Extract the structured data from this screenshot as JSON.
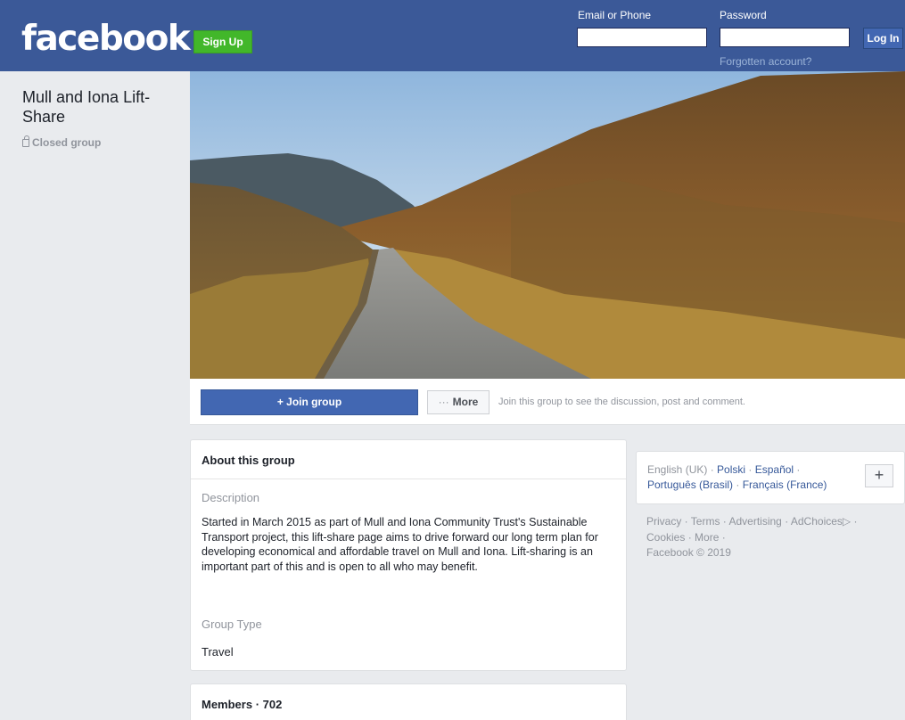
{
  "header": {
    "logo": "facebook",
    "signup_label": "Sign Up",
    "email_label": "Email or Phone",
    "password_label": "Password",
    "login_label": "Log In",
    "forgot_label": "Forgotten account?"
  },
  "group": {
    "name": "Mull and Iona Lift-Share",
    "privacy": "Closed group"
  },
  "actions": {
    "join_label": "+ Join group",
    "more_label": "More",
    "hint": "Join this group to see the discussion, post and comment."
  },
  "about": {
    "title": "About this group",
    "description_heading": "Description",
    "description": "Started in March 2015 as part of Mull and Iona Community Trust's Sustainable Transport project, this lift-share page aims to drive forward our long term plan for developing economical and affordable travel on Mull and Iona. Lift-sharing is an important part of this and is open to all who may benefit.",
    "type_heading": "Group Type",
    "type_value": "Travel"
  },
  "members": {
    "title": "Members · 702"
  },
  "languages": {
    "current": "English (UK)",
    "options": [
      "Polski",
      "Español",
      "Português (Brasil)",
      "Français (France)"
    ],
    "add_label": "+"
  },
  "footer": {
    "links": [
      "Privacy",
      "Terms",
      "Advertising",
      "AdChoices",
      "Cookies",
      "More"
    ],
    "copyright": "Facebook © 2019"
  },
  "colors": {
    "brand": "#3b5998",
    "signup": "#42b72a",
    "link": "#365899",
    "background": "#e9ebee"
  }
}
